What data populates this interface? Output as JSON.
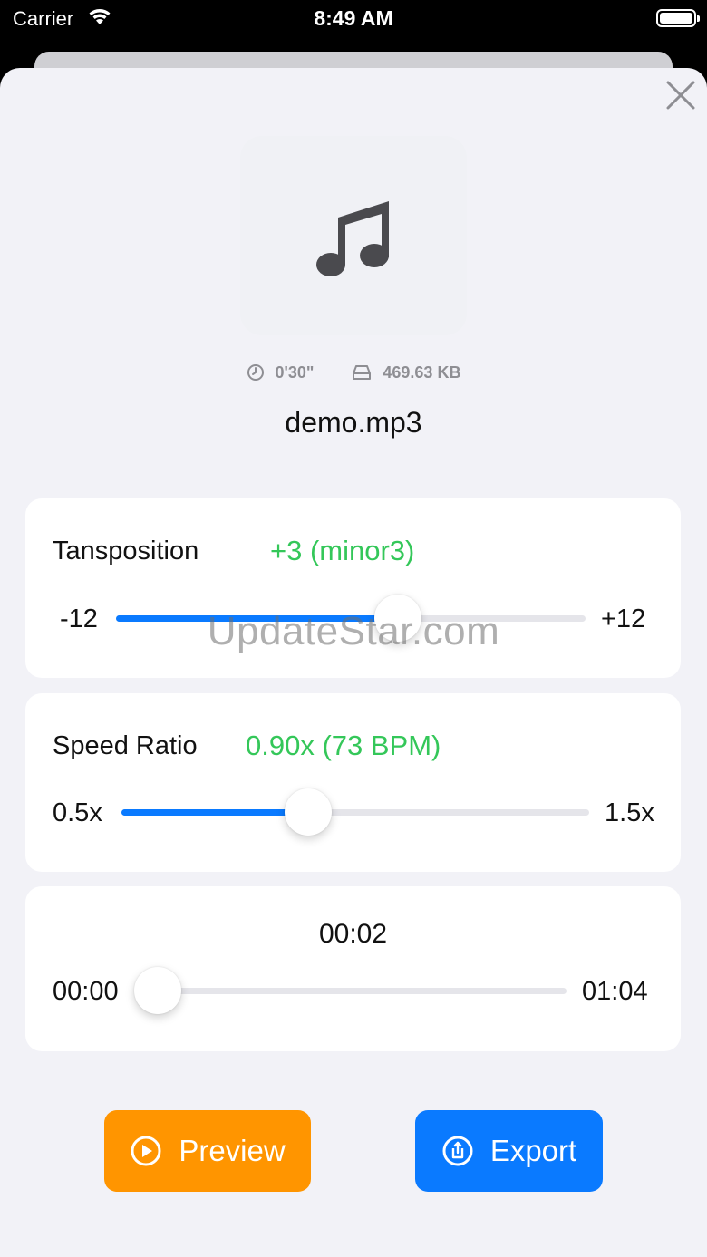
{
  "status_bar": {
    "carrier": "Carrier",
    "time": "8:49 AM"
  },
  "file": {
    "duration": "0'30\"",
    "size": "469.63 KB",
    "name": "demo.mp3"
  },
  "transposition": {
    "label": "Tansposition",
    "value": "+3 (minor3)",
    "min_label": "-12",
    "max_label": "+12",
    "position": 0.6
  },
  "speed": {
    "label": "Speed Ratio",
    "value": "0.90x (73 BPM)",
    "min_label": "0.5x",
    "max_label": "1.5x",
    "position": 0.4
  },
  "playback": {
    "current": "00:02",
    "start": "00:00",
    "end": "01:04",
    "position": 0.031
  },
  "actions": {
    "preview_label": "Preview",
    "export_label": "Export"
  },
  "watermark": "UpdateStar.com",
  "colors": {
    "accent_blue": "#0a7aff",
    "accent_orange": "#ff9500",
    "value_green": "#34c759"
  },
  "icons": [
    "wifi-icon",
    "battery-icon",
    "close-icon",
    "music-note-icon",
    "clock-icon",
    "storage-icon",
    "play-icon",
    "share-icon"
  ]
}
